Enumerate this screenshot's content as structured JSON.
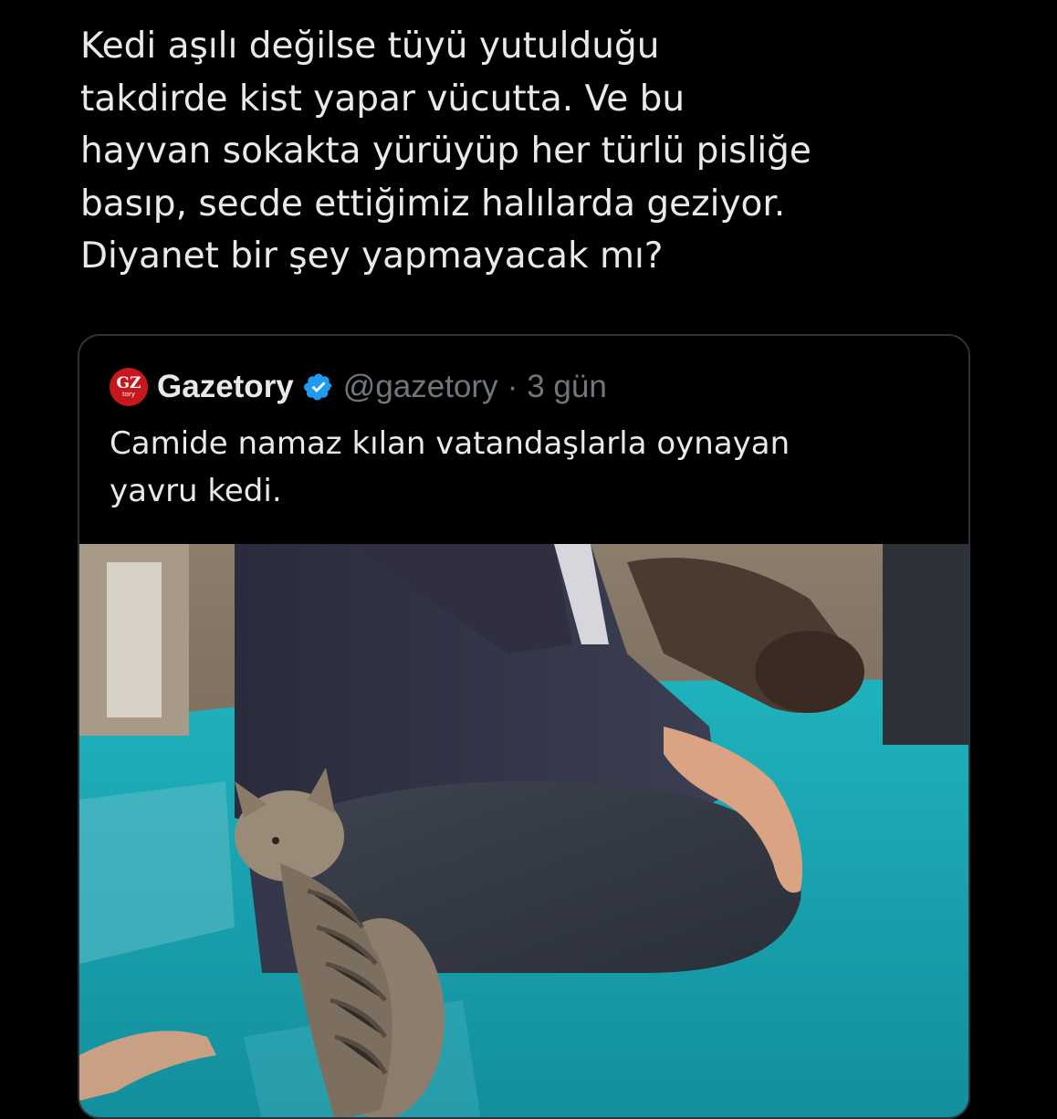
{
  "tweet": {
    "lines": [
      "Kedi aşılı değilse tüyü yutulduğu",
      "takdirde kist yapar vücutta. Ve bu",
      "hayvan sokakta yürüyüp her türlü pisliğe",
      "basıp, secde ettiğimiz halılarda geziyor.",
      "Diyanet bir şey yapmayacak mı?"
    ]
  },
  "quote": {
    "logo_text": "GZ",
    "logo_subtext": "tory",
    "author_name": "Gazetory",
    "handle": "@gazetory",
    "separator": "·",
    "time": "3 gün",
    "text_lines": [
      "Camide namaz kılan vatandaşlarla oynayan",
      "yavru kedi."
    ],
    "media_description": "kitten-beside-kneeling-worshipper"
  },
  "colors": {
    "background": "#000000",
    "text": "#e7e9ea",
    "secondary_text": "#71767b",
    "border": "#2f3336",
    "verified": "#1d9bf0",
    "carpet": "#1aa3b0",
    "logo": "#c8161d"
  },
  "icons": {
    "verified": "verified-badge-icon"
  }
}
